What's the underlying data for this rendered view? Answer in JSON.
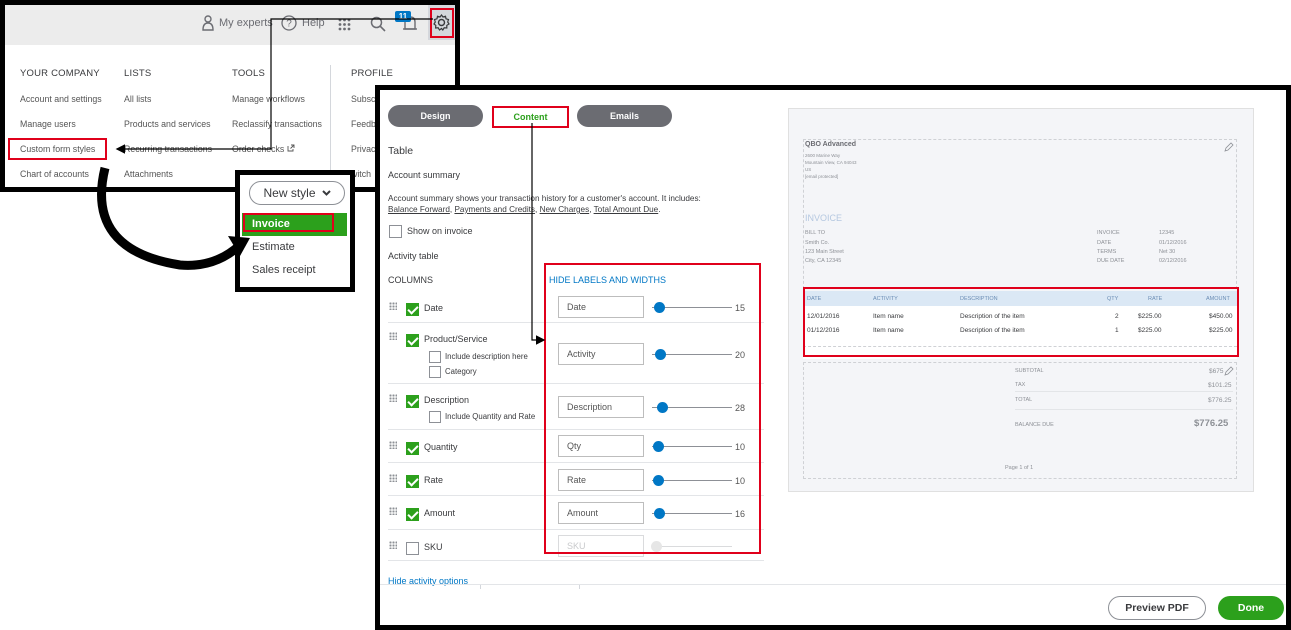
{
  "topbar": {
    "my_experts": "My experts",
    "help": "Help",
    "notification_count": "11"
  },
  "settings_menu": {
    "columns": [
      {
        "heading": "YOUR COMPANY",
        "items": [
          "Account and settings",
          "Manage users",
          "Custom form styles",
          "Chart of accounts"
        ]
      },
      {
        "heading": "LISTS",
        "items": [
          "All lists",
          "Products and services",
          "Recurring transactions",
          "Attachments"
        ]
      },
      {
        "heading": "TOOLS",
        "items": [
          "Manage workflows",
          "Reclassify transactions",
          "Order checks",
          ""
        ]
      },
      {
        "heading": "PROFILE",
        "items": [
          "Subsc",
          "Feedb",
          "Privacy",
          "witch"
        ]
      }
    ]
  },
  "new_style": {
    "button_label": "New style",
    "options": [
      "Invoice",
      "Estimate",
      "Sales receipt"
    ],
    "selected": "Invoice"
  },
  "tabs": {
    "design": "Design",
    "content": "Content",
    "emails": "Emails"
  },
  "content_panel": {
    "section_title": "Table",
    "account_summary_heading": "Account summary",
    "account_summary_desc": "Account summary shows your transaction history for a customer's account. It includes:",
    "account_summary_links": [
      "Balance Forward",
      "Payments and Credits",
      "New Charges",
      "Total Amount Due"
    ],
    "show_on_invoice": "Show on invoice",
    "activity_table_heading": "Activity table",
    "columns_heading": "COLUMNS",
    "hide_labels_link": "HIDE LABELS AND WIDTHS",
    "hide_activity_link": "Hide activity options",
    "rows": [
      {
        "name": "Date",
        "checked": true,
        "label": "Date",
        "width": "15",
        "fill": 0.15
      },
      {
        "name": "Product/Service",
        "checked": true,
        "label": "Activity",
        "width": "20",
        "fill": 0.2,
        "sub": [
          "Include description here",
          "Category"
        ]
      },
      {
        "name": "Description",
        "checked": true,
        "label": "Description",
        "width": "28",
        "fill": 0.28,
        "sub": [
          "Include Quantity and Rate"
        ]
      },
      {
        "name": "Quantity",
        "checked": true,
        "label": "Qty",
        "width": "10",
        "fill": 0.1
      },
      {
        "name": "Rate",
        "checked": true,
        "label": "Rate",
        "width": "10",
        "fill": 0.1
      },
      {
        "name": "Amount",
        "checked": true,
        "label": "Amount",
        "width": "16",
        "fill": 0.16
      },
      {
        "name": "SKU",
        "checked": false,
        "label": "SKU",
        "width": "",
        "fill": 0
      }
    ]
  },
  "preview": {
    "company": "QBO Advanced",
    "company_lines": [
      "2600 Marine Way",
      "Mountain View, CA 94043",
      "US",
      "[email protected]"
    ],
    "invoice_title": "INVOICE",
    "bill_to_label": "BILL TO",
    "bill_to": [
      "Smith Co.",
      "123 Main Street",
      "City, CA 12345"
    ],
    "meta_labels": [
      "INVOICE",
      "DATE",
      "TERMS",
      "DUE DATE"
    ],
    "meta_values": [
      "12345",
      "01/12/2016",
      "Net 30",
      "02/12/2016"
    ],
    "table_headers": [
      "DATE",
      "ACTIVITY",
      "DESCRIPTION",
      "QTY",
      "RATE",
      "AMOUNT"
    ],
    "table_rows": [
      [
        "12/01/2016",
        "Item name",
        "Description of the item",
        "2",
        "$225.00",
        "$450.00"
      ],
      [
        "01/12/2016",
        "Item name",
        "Description of the item",
        "1",
        "$225.00",
        "$225.00"
      ]
    ],
    "totals_labels": [
      "SUBTOTAL",
      "TAX",
      "TOTAL",
      "BALANCE DUE"
    ],
    "totals_values": [
      "$675",
      "$101.25",
      "$776.25",
      "$776.25"
    ],
    "page_label": "Page 1 of 1"
  },
  "footer": {
    "preview_pdf": "Preview PDF",
    "done": "Done"
  },
  "colors": {
    "brand_green": "#2ca01c",
    "link_blue": "#0077c5",
    "highlight_red": "#e0001b",
    "tab_gray": "#6b6c72"
  }
}
